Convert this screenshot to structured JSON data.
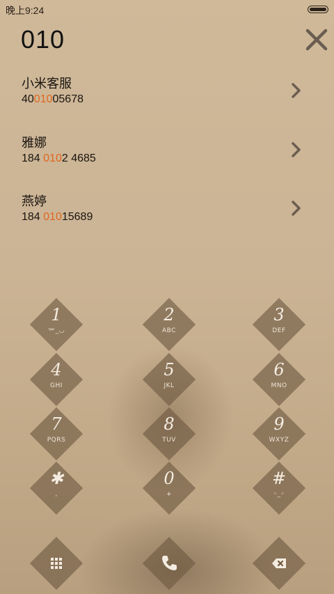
{
  "status_bar": {
    "time": "晚上9:24"
  },
  "dialer": {
    "query": "010"
  },
  "results": [
    {
      "name": "小米客服",
      "number_pre": "40",
      "number_hl": "010",
      "number_post": "05678"
    },
    {
      "name": "雅娜",
      "number_pre": "184 ",
      "number_hl": "010",
      "number_post": "2 4685"
    },
    {
      "name": "燕婷",
      "number_pre": "184 ",
      "number_hl": "010",
      "number_post": "15689"
    }
  ],
  "keypad": [
    {
      "digit": "1",
      "letters": "⌤_◡"
    },
    {
      "digit": "2",
      "letters": "ABC"
    },
    {
      "digit": "3",
      "letters": "DEF"
    },
    {
      "digit": "4",
      "letters": "GHI"
    },
    {
      "digit": "5",
      "letters": "JKL"
    },
    {
      "digit": "6",
      "letters": "MNO"
    },
    {
      "digit": "7",
      "letters": "PQRS"
    },
    {
      "digit": "8",
      "letters": "TUV"
    },
    {
      "digit": "9",
      "letters": "WXYZ"
    },
    {
      "digit": "✱",
      "letters": ","
    },
    {
      "digit": "0",
      "letters": "+"
    },
    {
      "digit": "#",
      "letters": "◦_◦"
    }
  ],
  "actions": [
    {
      "icon": "grid-icon"
    },
    {
      "icon": "phone-icon"
    },
    {
      "icon": "backspace-icon"
    }
  ],
  "colors": {
    "highlight": "#e0661e",
    "key_bg": "#6e5840",
    "text": "#1a1410"
  }
}
